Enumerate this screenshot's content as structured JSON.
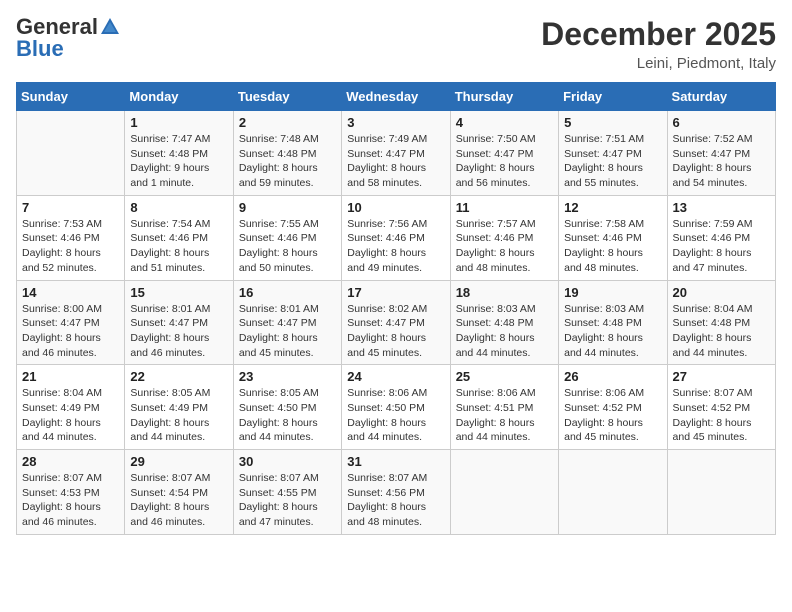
{
  "header": {
    "logo_general": "General",
    "logo_blue": "Blue",
    "month_title": "December 2025",
    "location": "Leini, Piedmont, Italy"
  },
  "days_of_week": [
    "Sunday",
    "Monday",
    "Tuesday",
    "Wednesday",
    "Thursday",
    "Friday",
    "Saturday"
  ],
  "weeks": [
    [
      {
        "day": "",
        "info": ""
      },
      {
        "day": "1",
        "info": "Sunrise: 7:47 AM\nSunset: 4:48 PM\nDaylight: 9 hours\nand 1 minute."
      },
      {
        "day": "2",
        "info": "Sunrise: 7:48 AM\nSunset: 4:48 PM\nDaylight: 8 hours\nand 59 minutes."
      },
      {
        "day": "3",
        "info": "Sunrise: 7:49 AM\nSunset: 4:47 PM\nDaylight: 8 hours\nand 58 minutes."
      },
      {
        "day": "4",
        "info": "Sunrise: 7:50 AM\nSunset: 4:47 PM\nDaylight: 8 hours\nand 56 minutes."
      },
      {
        "day": "5",
        "info": "Sunrise: 7:51 AM\nSunset: 4:47 PM\nDaylight: 8 hours\nand 55 minutes."
      },
      {
        "day": "6",
        "info": "Sunrise: 7:52 AM\nSunset: 4:47 PM\nDaylight: 8 hours\nand 54 minutes."
      }
    ],
    [
      {
        "day": "7",
        "info": "Sunrise: 7:53 AM\nSunset: 4:46 PM\nDaylight: 8 hours\nand 52 minutes."
      },
      {
        "day": "8",
        "info": "Sunrise: 7:54 AM\nSunset: 4:46 PM\nDaylight: 8 hours\nand 51 minutes."
      },
      {
        "day": "9",
        "info": "Sunrise: 7:55 AM\nSunset: 4:46 PM\nDaylight: 8 hours\nand 50 minutes."
      },
      {
        "day": "10",
        "info": "Sunrise: 7:56 AM\nSunset: 4:46 PM\nDaylight: 8 hours\nand 49 minutes."
      },
      {
        "day": "11",
        "info": "Sunrise: 7:57 AM\nSunset: 4:46 PM\nDaylight: 8 hours\nand 48 minutes."
      },
      {
        "day": "12",
        "info": "Sunrise: 7:58 AM\nSunset: 4:46 PM\nDaylight: 8 hours\nand 48 minutes."
      },
      {
        "day": "13",
        "info": "Sunrise: 7:59 AM\nSunset: 4:46 PM\nDaylight: 8 hours\nand 47 minutes."
      }
    ],
    [
      {
        "day": "14",
        "info": "Sunrise: 8:00 AM\nSunset: 4:47 PM\nDaylight: 8 hours\nand 46 minutes."
      },
      {
        "day": "15",
        "info": "Sunrise: 8:01 AM\nSunset: 4:47 PM\nDaylight: 8 hours\nand 46 minutes."
      },
      {
        "day": "16",
        "info": "Sunrise: 8:01 AM\nSunset: 4:47 PM\nDaylight: 8 hours\nand 45 minutes."
      },
      {
        "day": "17",
        "info": "Sunrise: 8:02 AM\nSunset: 4:47 PM\nDaylight: 8 hours\nand 45 minutes."
      },
      {
        "day": "18",
        "info": "Sunrise: 8:03 AM\nSunset: 4:48 PM\nDaylight: 8 hours\nand 44 minutes."
      },
      {
        "day": "19",
        "info": "Sunrise: 8:03 AM\nSunset: 4:48 PM\nDaylight: 8 hours\nand 44 minutes."
      },
      {
        "day": "20",
        "info": "Sunrise: 8:04 AM\nSunset: 4:48 PM\nDaylight: 8 hours\nand 44 minutes."
      }
    ],
    [
      {
        "day": "21",
        "info": "Sunrise: 8:04 AM\nSunset: 4:49 PM\nDaylight: 8 hours\nand 44 minutes."
      },
      {
        "day": "22",
        "info": "Sunrise: 8:05 AM\nSunset: 4:49 PM\nDaylight: 8 hours\nand 44 minutes."
      },
      {
        "day": "23",
        "info": "Sunrise: 8:05 AM\nSunset: 4:50 PM\nDaylight: 8 hours\nand 44 minutes."
      },
      {
        "day": "24",
        "info": "Sunrise: 8:06 AM\nSunset: 4:50 PM\nDaylight: 8 hours\nand 44 minutes."
      },
      {
        "day": "25",
        "info": "Sunrise: 8:06 AM\nSunset: 4:51 PM\nDaylight: 8 hours\nand 44 minutes."
      },
      {
        "day": "26",
        "info": "Sunrise: 8:06 AM\nSunset: 4:52 PM\nDaylight: 8 hours\nand 45 minutes."
      },
      {
        "day": "27",
        "info": "Sunrise: 8:07 AM\nSunset: 4:52 PM\nDaylight: 8 hours\nand 45 minutes."
      }
    ],
    [
      {
        "day": "28",
        "info": "Sunrise: 8:07 AM\nSunset: 4:53 PM\nDaylight: 8 hours\nand 46 minutes."
      },
      {
        "day": "29",
        "info": "Sunrise: 8:07 AM\nSunset: 4:54 PM\nDaylight: 8 hours\nand 46 minutes."
      },
      {
        "day": "30",
        "info": "Sunrise: 8:07 AM\nSunset: 4:55 PM\nDaylight: 8 hours\nand 47 minutes."
      },
      {
        "day": "31",
        "info": "Sunrise: 8:07 AM\nSunset: 4:56 PM\nDaylight: 8 hours\nand 48 minutes."
      },
      {
        "day": "",
        "info": ""
      },
      {
        "day": "",
        "info": ""
      },
      {
        "day": "",
        "info": ""
      }
    ]
  ]
}
